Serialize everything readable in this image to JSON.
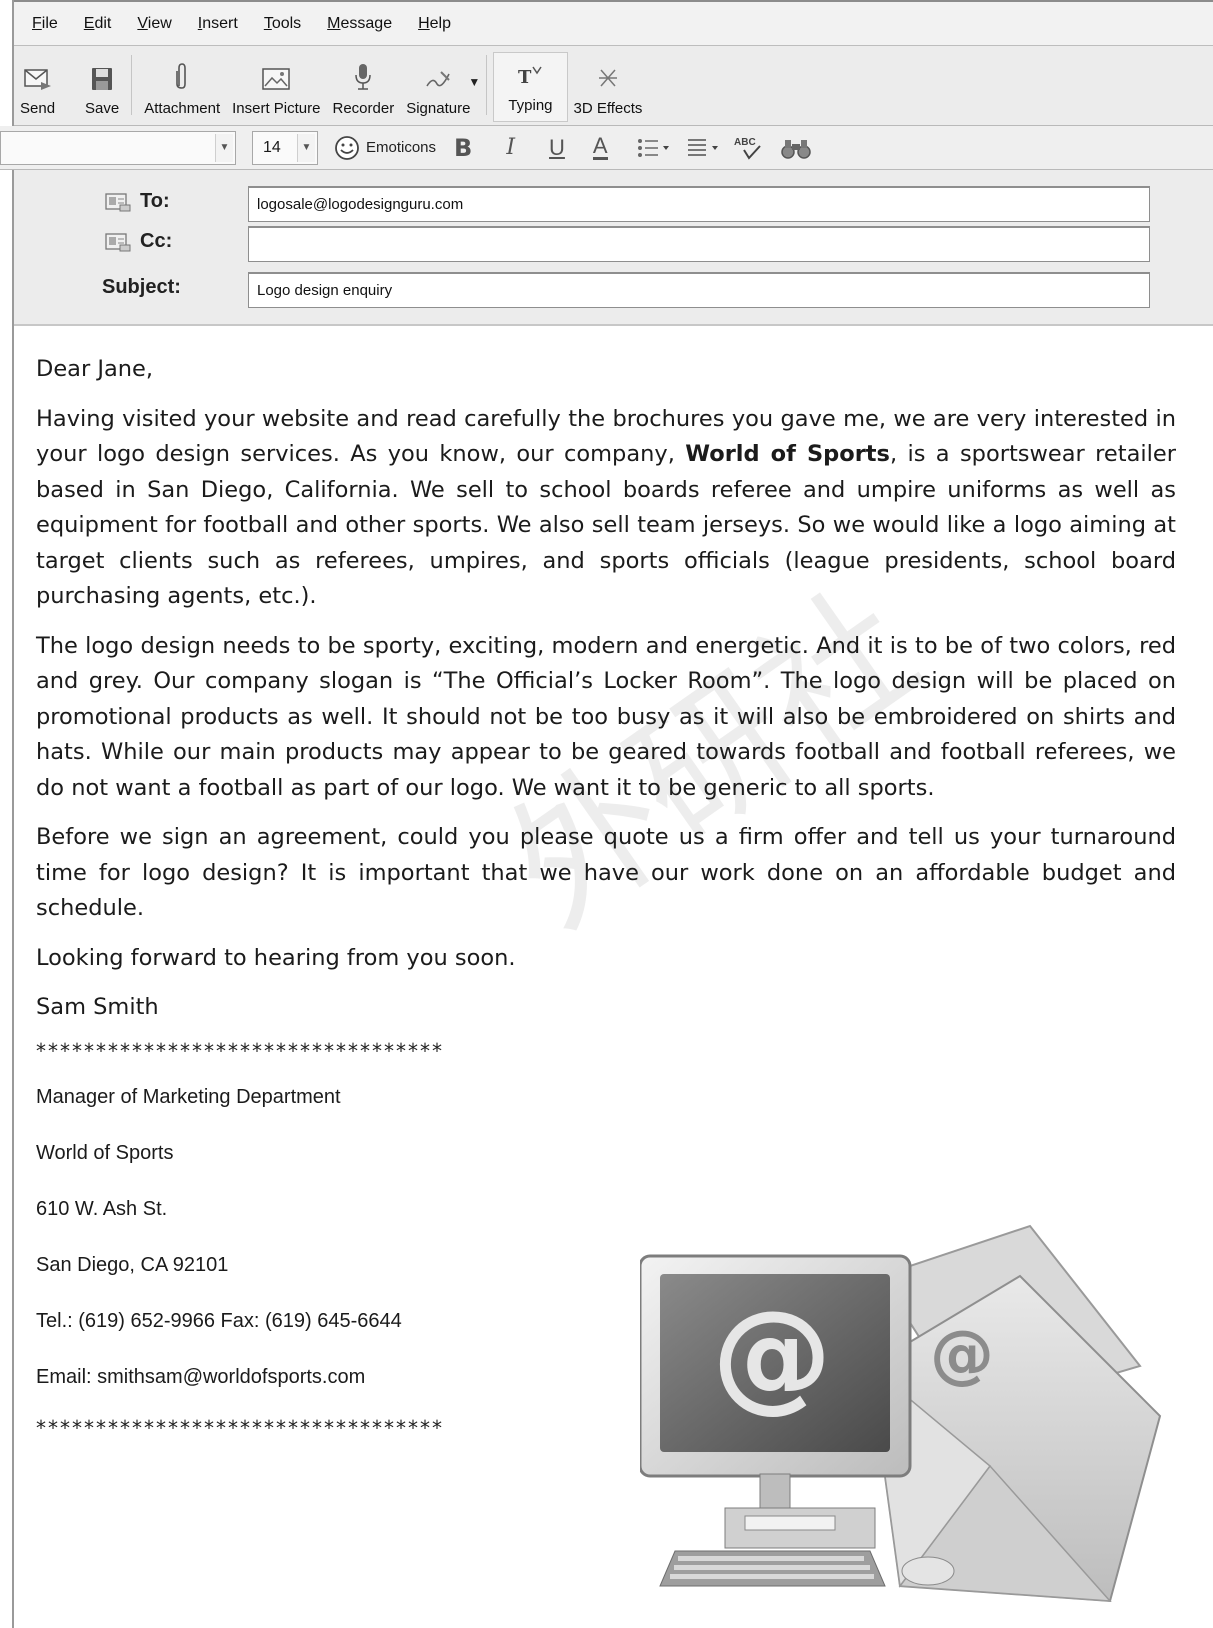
{
  "menu": {
    "items": [
      {
        "label": "File",
        "ul": "F",
        "rest": "ile"
      },
      {
        "label": "Edit",
        "ul": "E",
        "rest": "dit"
      },
      {
        "label": "View",
        "ul": "V",
        "rest": "iew"
      },
      {
        "label": "Insert",
        "ul": "I",
        "rest": "nsert"
      },
      {
        "label": "Tools",
        "ul": "T",
        "rest": "ools"
      },
      {
        "label": "Message",
        "ul": "M",
        "rest": "essage"
      },
      {
        "label": "Help",
        "ul": "H",
        "rest": "elp"
      }
    ]
  },
  "toolbar": {
    "send": "Send",
    "save": "Save",
    "attachment": "Attachment",
    "insert_picture": "Insert Picture",
    "recorder": "Recorder",
    "signature": "Signature",
    "typing": "Typing",
    "effects": "3D Effects"
  },
  "format": {
    "font": "",
    "size": "14",
    "emoticons": "Emoticons",
    "bold": "B",
    "italic": "I",
    "underline": "U",
    "color": "A",
    "spell": "ABC"
  },
  "fields": {
    "to_label": "To:",
    "to_value": "logosale@logodesignguru.com",
    "cc_label": "Cc:",
    "cc_value": "",
    "subject_label": "Subject:",
    "subject_value": "Logo design enquiry"
  },
  "body": {
    "greeting": "Dear Jane,",
    "p1_a": "Having visited your website and read carefully the brochures you gave me, we are very interested in your logo design services. As you know, our company, ",
    "p1_bold": "World of Sports",
    "p1_b": ", is a sportswear retailer based in San Diego, California. We sell to school boards referee and umpire uniforms as well as equipment for football and other sports. We also sell team jerseys. So we would like a logo aiming at target clients such as referees, umpires, and sports officials (league presidents, school board purchasing agents, etc.).",
    "p2": "The logo design needs to be sporty, exciting, modern and energetic. And it is to be of two colors, red and grey. Our company slogan is “The Official’s Locker Room”. The logo design will be placed on promotional products as well. It should not be too busy as it will also be embroidered on shirts and hats. While our main products may appear to be geared towards football and football referees, we do not want a football as part of our logo. We want it to be generic to all sports.",
    "p3": "Before we sign an agreement, could you please quote us a firm offer and tell us your turnaround time for logo design? It is important that we have our work done on an affordable budget and schedule.",
    "closing": "Looking forward to hearing from you soon.",
    "name": "Sam Smith"
  },
  "signature": {
    "stars": "**********************************",
    "title": "Manager of Marketing Department",
    "company": "World of Sports",
    "street": "610 W. Ash St.",
    "city": "San Diego, CA 92101",
    "phone": "Tel.: (619) 652-9966  Fax: (619) 645-6644",
    "email": "Email: smithsam@worldofsports.com"
  },
  "watermark": "外研社",
  "illustration": {
    "monitor_symbol": "@",
    "envelope_symbol": "@"
  }
}
